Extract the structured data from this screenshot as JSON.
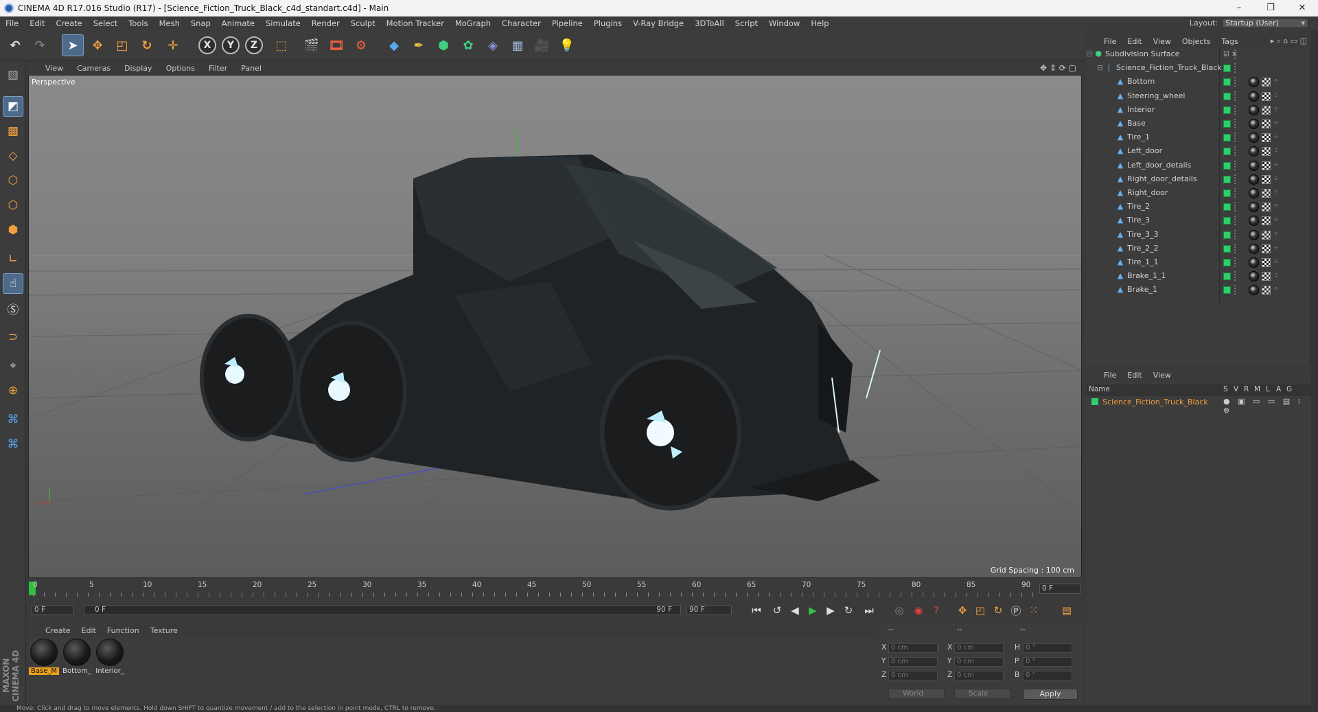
{
  "window": {
    "title": "CINEMA 4D R17.016 Studio (R17) - [Science_Fiction_Truck_Black_c4d_standart.c4d] - Main",
    "controls": [
      "–",
      "❐",
      "✕"
    ]
  },
  "menubar": {
    "items": [
      "File",
      "Edit",
      "Create",
      "Select",
      "Tools",
      "Mesh",
      "Snap",
      "Animate",
      "Simulate",
      "Render",
      "Sculpt",
      "Motion Tracker",
      "MoGraph",
      "Character",
      "Pipeline",
      "Plugins",
      "V-Ray Bridge",
      "3DToAll",
      "Script",
      "Window",
      "Help"
    ],
    "layout_label": "Layout:",
    "layout_value": "Startup (User)"
  },
  "toolbar": {
    "axis_x": "X",
    "axis_y": "Y",
    "axis_z": "Z"
  },
  "viewport": {
    "menu": [
      "View",
      "Cameras",
      "Display",
      "Options",
      "Filter",
      "Panel"
    ],
    "camera_label": "Perspective",
    "grid_spacing": "Grid Spacing : 100 cm"
  },
  "timeline": {
    "ticks": [
      "0",
      "5",
      "10",
      "15",
      "20",
      "25",
      "30",
      "35",
      "40",
      "45",
      "50",
      "55",
      "60",
      "65",
      "70",
      "75",
      "80",
      "85",
      "90"
    ],
    "current_frame": "0 F"
  },
  "transport": {
    "start_field": "0 F",
    "range_start": "0 F",
    "range_end": "90 F",
    "end_field": "90 F"
  },
  "material_manager": {
    "menu": [
      "Create",
      "Edit",
      "Function",
      "Texture"
    ],
    "materials": [
      "Base_M",
      "Bottom_",
      "Interior_"
    ]
  },
  "coordinates": {
    "header": [
      "--",
      "--",
      "--"
    ],
    "rows": [
      {
        "a": "X",
        "av": "0 cm",
        "b": "X",
        "bv": "0 cm",
        "c": "H",
        "cv": "0 °"
      },
      {
        "a": "Y",
        "av": "0 cm",
        "b": "Y",
        "bv": "0 cm",
        "c": "P",
        "cv": "0 °"
      },
      {
        "a": "Z",
        "av": "0 cm",
        "b": "Z",
        "bv": "0 cm",
        "c": "B",
        "cv": "0 °"
      }
    ],
    "space": "World",
    "mode": "Scale",
    "apply": "Apply"
  },
  "status": "Move: Click and drag to move elements. Hold down SHIFT to quantize movement / add to the selection in point mode, CTRL to remove.",
  "object_manager": {
    "menu": [
      "File",
      "Edit",
      "View",
      "Objects",
      "Tags"
    ],
    "objects": [
      {
        "name": "Subdivision Surface",
        "level": 0
      },
      {
        "name": "Science_Fiction_Truck_Black",
        "level": 1
      },
      {
        "name": "Bottom",
        "level": 2
      },
      {
        "name": "Steering_wheel",
        "level": 2
      },
      {
        "name": "Interior",
        "level": 2
      },
      {
        "name": "Base",
        "level": 2
      },
      {
        "name": "Tire_1",
        "level": 2
      },
      {
        "name": "Left_door",
        "level": 2
      },
      {
        "name": "Left_door_details",
        "level": 2
      },
      {
        "name": "Right_door_details",
        "level": 2
      },
      {
        "name": "Right_door",
        "level": 2
      },
      {
        "name": "Tire_2",
        "level": 2
      },
      {
        "name": "Tire_3",
        "level": 2
      },
      {
        "name": "Tire_3_3",
        "level": 2
      },
      {
        "name": "Tire_2_2",
        "level": 2
      },
      {
        "name": "Tire_1_1",
        "level": 2
      },
      {
        "name": "Brake_1_1",
        "level": 2
      },
      {
        "name": "Brake_1",
        "level": 2
      }
    ]
  },
  "layer_manager": {
    "menu": [
      "File",
      "Edit",
      "View"
    ],
    "columns": [
      "Name",
      "S",
      "V",
      "R",
      "M",
      "L",
      "A",
      "G"
    ],
    "layer": "Science_Fiction_Truck_Black",
    "layer_color": "#2ccf6a"
  },
  "colors": {
    "accent_selection": "#4d6a8a",
    "layer_text": "#f0a040",
    "play": "#34c040"
  }
}
